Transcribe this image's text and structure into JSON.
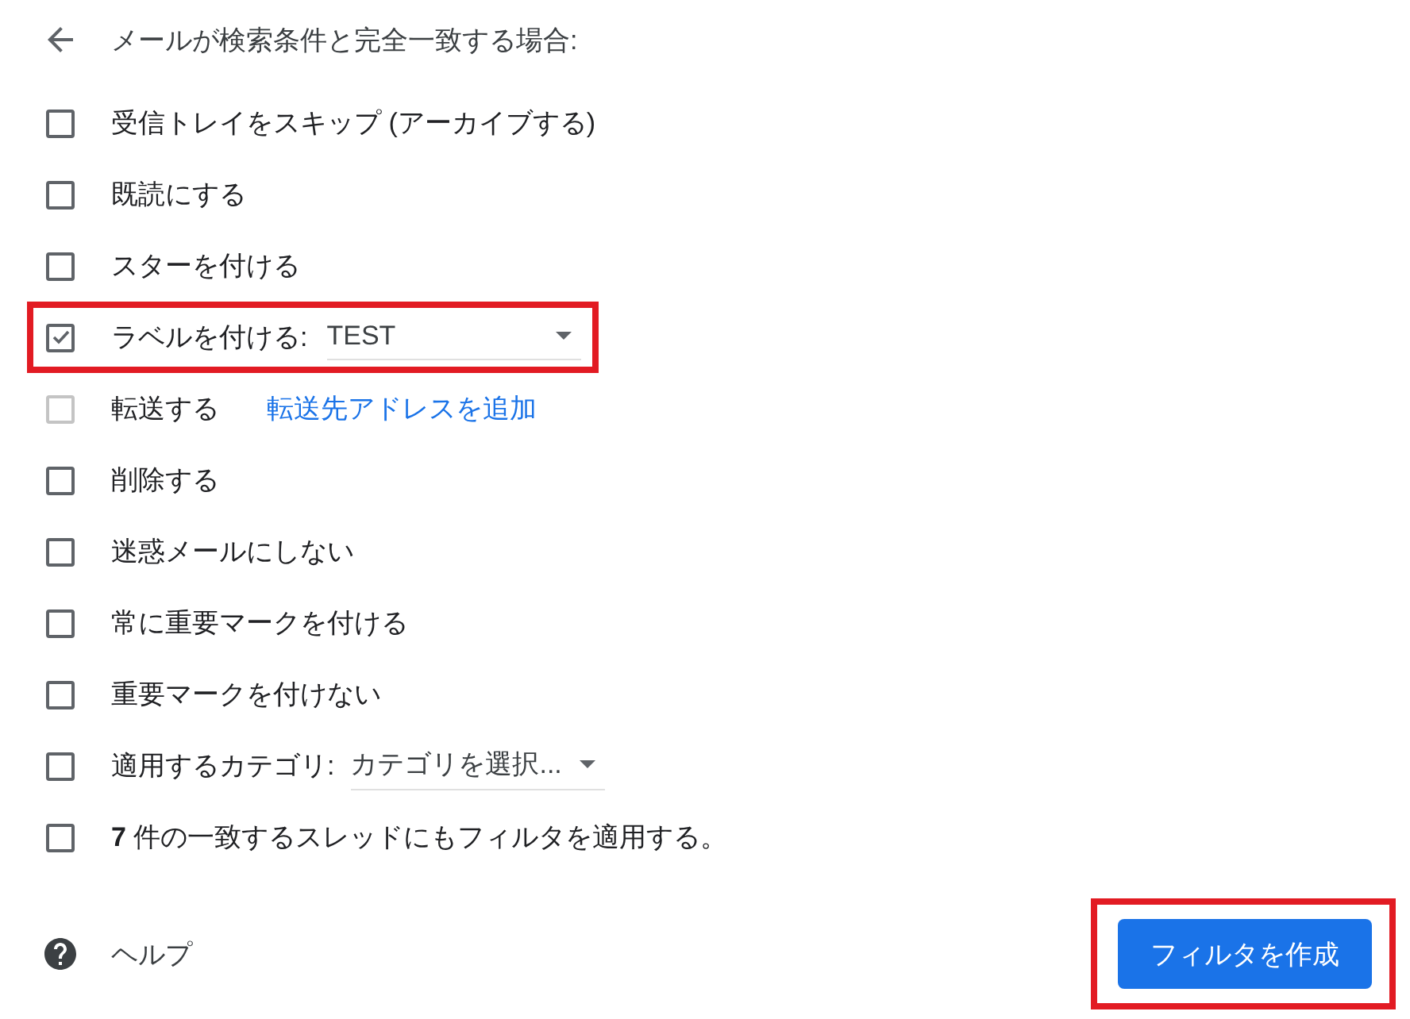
{
  "header": {
    "title": "メールが検索条件と完全一致する場合:"
  },
  "actions": [
    {
      "kind": "checkbox",
      "label": "受信トレイをスキップ (アーカイブする)",
      "checked": false,
      "disabled": false,
      "highlighted": false
    },
    {
      "kind": "checkbox",
      "label": "既読にする",
      "checked": false,
      "disabled": false,
      "highlighted": false
    },
    {
      "kind": "checkbox",
      "label": "スターを付ける",
      "checked": false,
      "disabled": false,
      "highlighted": false
    },
    {
      "kind": "select",
      "label": "ラベルを付ける:",
      "value": "TEST",
      "checked": true,
      "disabled": false,
      "highlighted": true
    },
    {
      "kind": "link",
      "label": "転送する",
      "link": "転送先アドレスを追加",
      "checked": false,
      "disabled": true,
      "highlighted": false
    },
    {
      "kind": "checkbox",
      "label": "削除する",
      "checked": false,
      "disabled": false,
      "highlighted": false
    },
    {
      "kind": "checkbox",
      "label": "迷惑メールにしない",
      "checked": false,
      "disabled": false,
      "highlighted": false
    },
    {
      "kind": "checkbox",
      "label": "常に重要マークを付ける",
      "checked": false,
      "disabled": false,
      "highlighted": false
    },
    {
      "kind": "checkbox",
      "label": "重要マークを付けない",
      "checked": false,
      "disabled": false,
      "highlighted": false
    },
    {
      "kind": "select",
      "label": "適用するカテゴリ:",
      "value": "カテゴリを選択...",
      "checked": false,
      "disabled": false,
      "highlighted": false
    },
    {
      "kind": "checkbox",
      "label": "**7** 件の一致するスレッドにもフィルタを適用する。",
      "checked": false,
      "disabled": false,
      "highlighted": false
    }
  ],
  "footer": {
    "help": "ヘルプ",
    "create_button": {
      "label": "フィルタを作成",
      "highlighted": true
    }
  }
}
